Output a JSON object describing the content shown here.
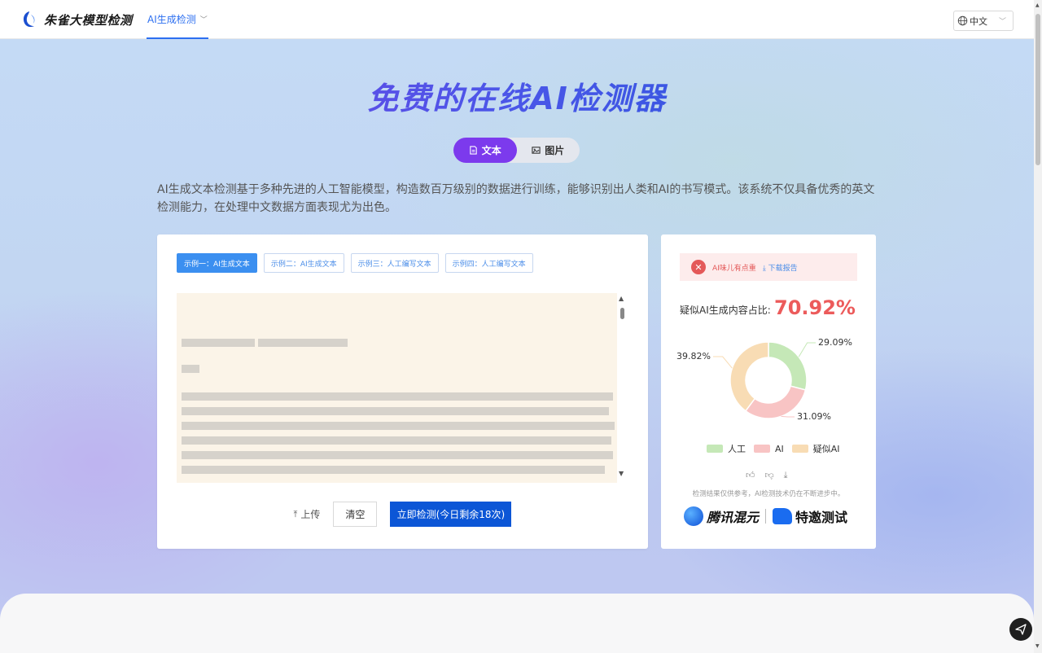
{
  "header": {
    "brand": "朱雀大模型检测",
    "nav_tab": "AI生成检测",
    "language": "中文"
  },
  "hero": {
    "title": "免费的在线AI检测器",
    "modes": [
      {
        "label": "文本",
        "icon": "document-icon",
        "active": true
      },
      {
        "label": "图片",
        "icon": "image-icon",
        "active": false
      }
    ],
    "description": "AI生成文本检测基于多种先进的人工智能模型，构造数百万级别的数据进行训练，能够识别出人类和AI的书写模式。该系统不仅具备优秀的英文检测能力，在处理中文数据方面表现尤为出色。"
  },
  "detector": {
    "examples": [
      {
        "label": "示例一：AI生成文本",
        "active": true
      },
      {
        "label": "示例二：AI生成文本",
        "active": false
      },
      {
        "label": "示例三：人工编写文本",
        "active": false
      },
      {
        "label": "示例四：人工编写文本",
        "active": false
      }
    ],
    "upload_label": "上传",
    "clear_label": "清空",
    "detect_label": "立即检测(今日剩余18次)"
  },
  "result": {
    "alert_text": "AI味儿有点重",
    "download_label": "下载报告",
    "ratio_label": "疑似AI生成内容占比:",
    "ratio_value": "70.92%",
    "disclaimer": "检测结果仅供参考，AI检测技术仍在不断进步中。",
    "brand_1": "腾讯混元",
    "brand_2": "特邀测试",
    "colors": {
      "human": "#c5e8b7",
      "ai": "#f8c4c4",
      "suspect": "#f8dcb4"
    }
  },
  "chart_data": {
    "type": "pie",
    "categories": [
      "人工",
      "AI",
      "疑似AI"
    ],
    "values": [
      29.09,
      31.09,
      39.82
    ],
    "value_labels": [
      "29.09%",
      "31.09%",
      "39.82%"
    ],
    "colors": [
      "#c5e8b7",
      "#f8c4c4",
      "#f8dcb4"
    ]
  }
}
